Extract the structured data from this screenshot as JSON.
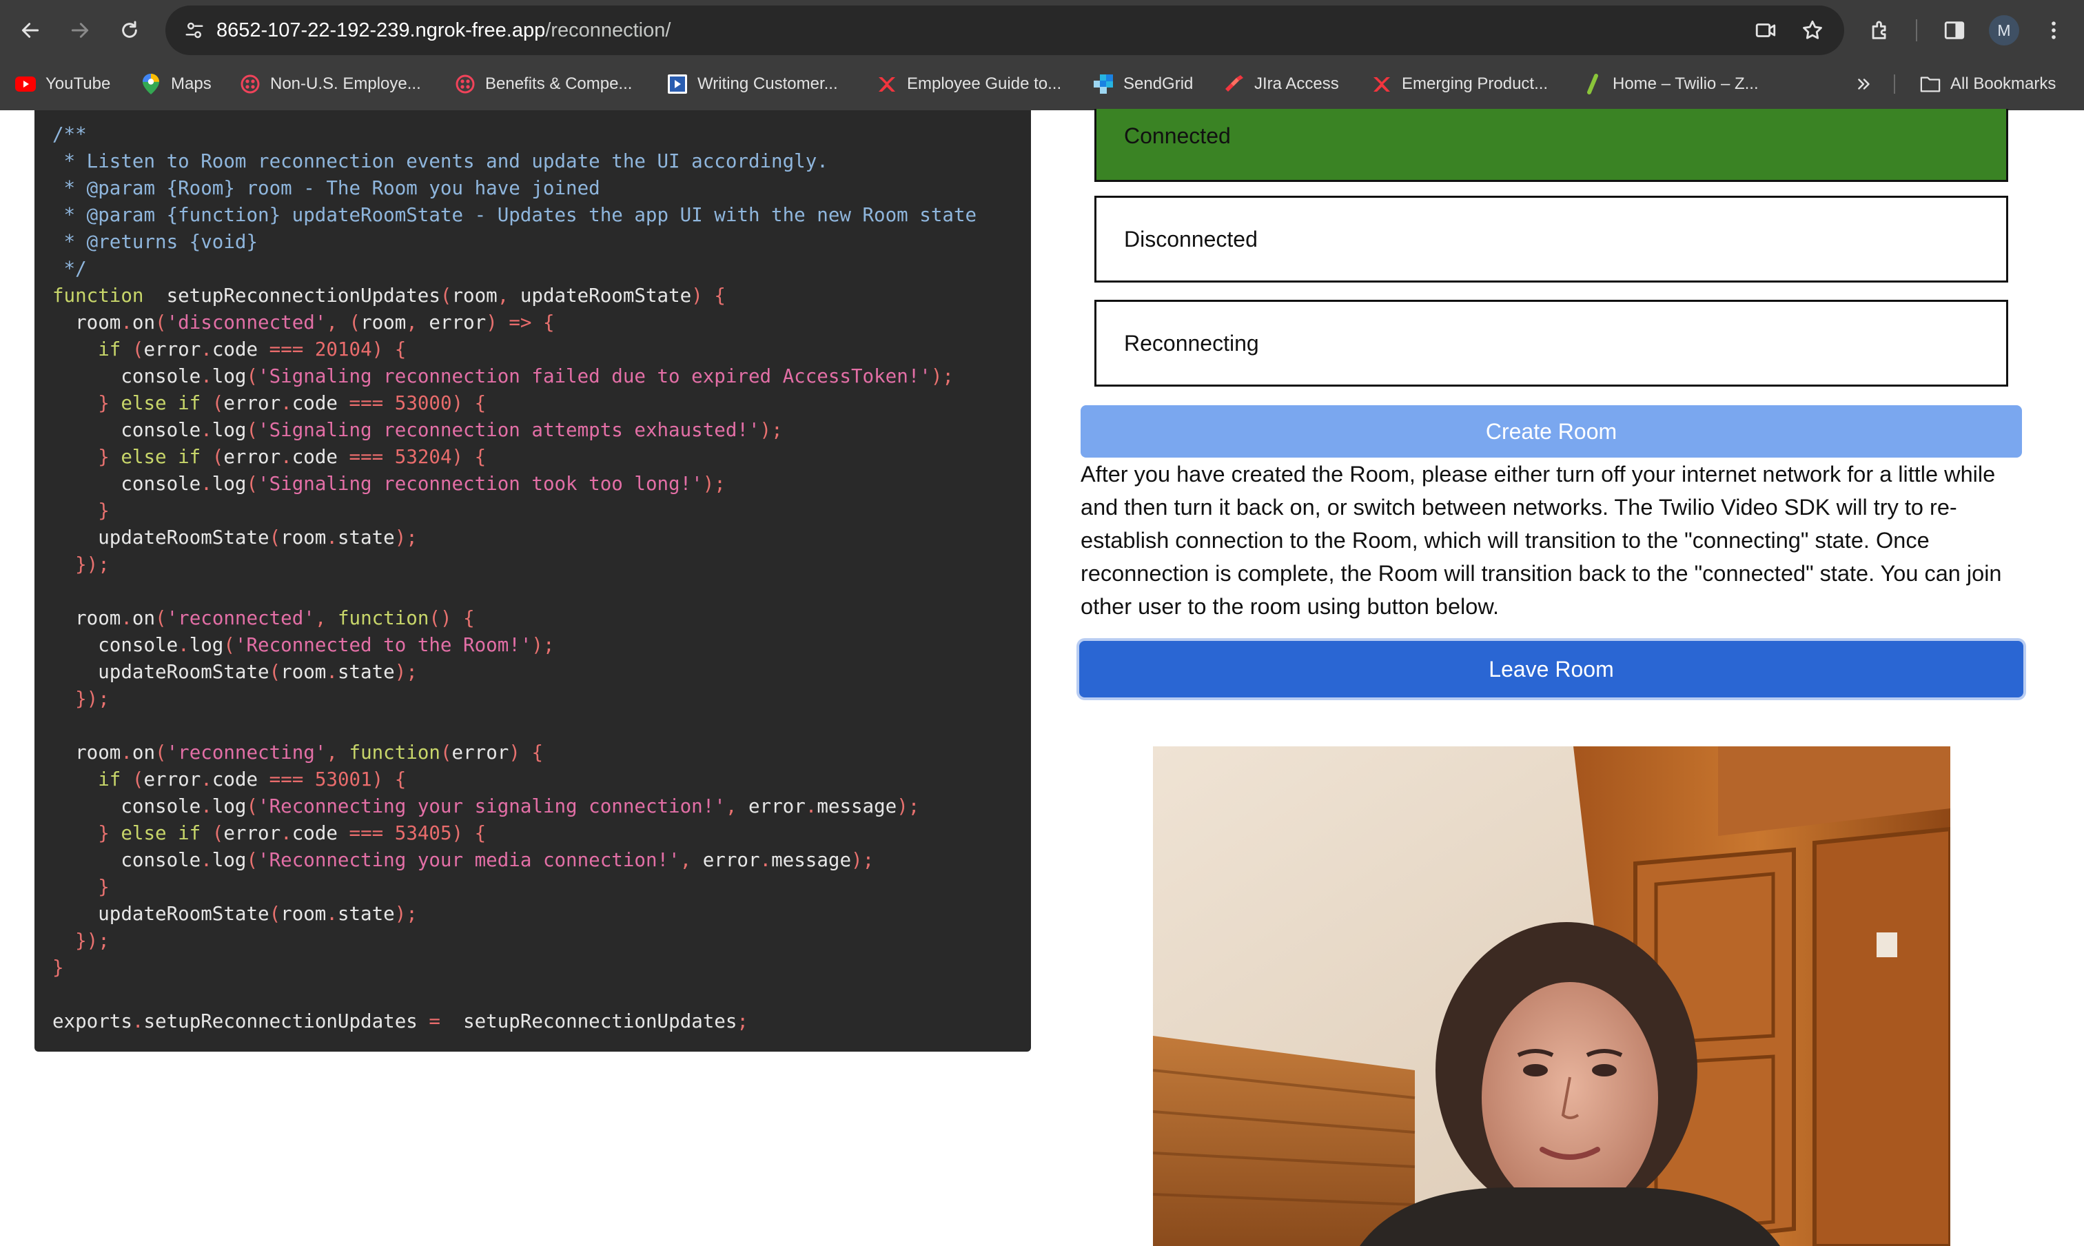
{
  "browser": {
    "url_host": "8652-107-22-192-239.ngrok-free.app",
    "url_path": "/reconnection/",
    "avatar_letter": "M",
    "bookmarks": [
      {
        "label": "YouTube",
        "icon": "youtube-icon"
      },
      {
        "label": "Maps",
        "icon": "maps-icon"
      },
      {
        "label": "Non-U.S. Employe...",
        "icon": "globe-icon"
      },
      {
        "label": "Benefits & Compe...",
        "icon": "globe-icon"
      },
      {
        "label": "Writing Customer...",
        "icon": "docs-icon"
      },
      {
        "label": "Employee Guide to...",
        "icon": "x-logo-icon"
      },
      {
        "label": "SendGrid",
        "icon": "sendgrid-icon"
      },
      {
        "label": "JIra Access",
        "icon": "jira-icon"
      },
      {
        "label": "Emerging Product...",
        "icon": "x-logo-icon"
      },
      {
        "label": "Home – Twilio – Z...",
        "icon": "leaf-icon"
      }
    ],
    "all_bookmarks_label": "All Bookmarks",
    "colors": {
      "chrome": "#3c3c3c",
      "omnibox": "#282828"
    }
  },
  "code": {
    "lines": [
      [
        [
          "c-com",
          "/**"
        ]
      ],
      [
        [
          "c-com",
          " * Listen to Room reconnection events and update the UI accordingly."
        ]
      ],
      [
        [
          "c-com",
          " * @param {Room} room - The Room you have joined"
        ]
      ],
      [
        [
          "c-com",
          " * @param {function} updateRoomState - Updates the app UI with the new Room state"
        ]
      ],
      [
        [
          "c-com",
          " * @returns {void}"
        ]
      ],
      [
        [
          "c-com",
          " */"
        ]
      ],
      [
        [
          "c-kw",
          "function"
        ],
        [
          "",
          "  setupReconnectionUpdates"
        ],
        [
          "c-p",
          "("
        ],
        [
          "",
          "room"
        ],
        [
          "c-p",
          ", "
        ],
        [
          "",
          "updateRoomState"
        ],
        [
          "c-p",
          ") {"
        ]
      ],
      [
        [
          "",
          "  room"
        ],
        [
          "c-p",
          "."
        ],
        [
          "",
          "on"
        ],
        [
          "c-p",
          "("
        ],
        [
          "c-str",
          "'disconnected'"
        ],
        [
          "c-p",
          ", ("
        ],
        [
          "",
          "room"
        ],
        [
          "c-p",
          ", "
        ],
        [
          "",
          "error"
        ],
        [
          "c-p",
          ") "
        ],
        [
          "c-op",
          "=>"
        ],
        [
          "c-p",
          " {"
        ]
      ],
      [
        [
          "",
          "    "
        ],
        [
          "c-kw",
          "if"
        ],
        [
          "c-p",
          " ("
        ],
        [
          "",
          "error"
        ],
        [
          "c-p",
          "."
        ],
        [
          "",
          "code "
        ],
        [
          "c-op",
          "==="
        ],
        [
          "c-num",
          " 20104"
        ],
        [
          "c-p",
          ") {"
        ]
      ],
      [
        [
          "",
          "      console"
        ],
        [
          "c-p",
          "."
        ],
        [
          "",
          "log"
        ],
        [
          "c-p",
          "("
        ],
        [
          "c-str",
          "'Signaling reconnection failed due to expired AccessToken!'"
        ],
        [
          "c-p",
          ");"
        ]
      ],
      [
        [
          "c-p",
          "    } "
        ],
        [
          "c-kw",
          "else if"
        ],
        [
          "c-p",
          " ("
        ],
        [
          "",
          "error"
        ],
        [
          "c-p",
          "."
        ],
        [
          "",
          "code "
        ],
        [
          "c-op",
          "==="
        ],
        [
          "c-num",
          " 53000"
        ],
        [
          "c-p",
          ") {"
        ]
      ],
      [
        [
          "",
          "      console"
        ],
        [
          "c-p",
          "."
        ],
        [
          "",
          "log"
        ],
        [
          "c-p",
          "("
        ],
        [
          "c-str",
          "'Signaling reconnection attempts exhausted!'"
        ],
        [
          "c-p",
          ");"
        ]
      ],
      [
        [
          "c-p",
          "    } "
        ],
        [
          "c-kw",
          "else if"
        ],
        [
          "c-p",
          " ("
        ],
        [
          "",
          "error"
        ],
        [
          "c-p",
          "."
        ],
        [
          "",
          "code "
        ],
        [
          "c-op",
          "==="
        ],
        [
          "c-num",
          " 53204"
        ],
        [
          "c-p",
          ") {"
        ]
      ],
      [
        [
          "",
          "      console"
        ],
        [
          "c-p",
          "."
        ],
        [
          "",
          "log"
        ],
        [
          "c-p",
          "("
        ],
        [
          "c-str",
          "'Signaling reconnection took too long!'"
        ],
        [
          "c-p",
          ");"
        ]
      ],
      [
        [
          "c-p",
          "    }"
        ]
      ],
      [
        [
          "",
          "    updateRoomState"
        ],
        [
          "c-p",
          "("
        ],
        [
          "",
          "room"
        ],
        [
          "c-p",
          "."
        ],
        [
          "",
          "state"
        ],
        [
          "c-p",
          ");"
        ]
      ],
      [
        [
          "c-p",
          "  });"
        ]
      ],
      [
        [
          "",
          ""
        ]
      ],
      [
        [
          "",
          "  room"
        ],
        [
          "c-p",
          "."
        ],
        [
          "",
          "on"
        ],
        [
          "c-p",
          "("
        ],
        [
          "c-str",
          "'reconnected'"
        ],
        [
          "c-p",
          ", "
        ],
        [
          "c-kw",
          "function"
        ],
        [
          "c-p",
          "() {"
        ]
      ],
      [
        [
          "",
          "    console"
        ],
        [
          "c-p",
          "."
        ],
        [
          "",
          "log"
        ],
        [
          "c-p",
          "("
        ],
        [
          "c-str",
          "'Reconnected to the Room!'"
        ],
        [
          "c-p",
          ");"
        ]
      ],
      [
        [
          "",
          "    updateRoomState"
        ],
        [
          "c-p",
          "("
        ],
        [
          "",
          "room"
        ],
        [
          "c-p",
          "."
        ],
        [
          "",
          "state"
        ],
        [
          "c-p",
          ");"
        ]
      ],
      [
        [
          "c-p",
          "  });"
        ]
      ],
      [
        [
          "",
          ""
        ]
      ],
      [
        [
          "",
          "  room"
        ],
        [
          "c-p",
          "."
        ],
        [
          "",
          "on"
        ],
        [
          "c-p",
          "("
        ],
        [
          "c-str",
          "'reconnecting'"
        ],
        [
          "c-p",
          ", "
        ],
        [
          "c-kw",
          "function"
        ],
        [
          "c-p",
          "("
        ],
        [
          "",
          "error"
        ],
        [
          "c-p",
          ") {"
        ]
      ],
      [
        [
          "",
          "    "
        ],
        [
          "c-kw",
          "if"
        ],
        [
          "c-p",
          " ("
        ],
        [
          "",
          "error"
        ],
        [
          "c-p",
          "."
        ],
        [
          "",
          "code "
        ],
        [
          "c-op",
          "==="
        ],
        [
          "c-num",
          " 53001"
        ],
        [
          "c-p",
          ") {"
        ]
      ],
      [
        [
          "",
          "      console"
        ],
        [
          "c-p",
          "."
        ],
        [
          "",
          "log"
        ],
        [
          "c-p",
          "("
        ],
        [
          "c-str",
          "'Reconnecting your signaling connection!'"
        ],
        [
          "c-p",
          ", "
        ],
        [
          "",
          "error"
        ],
        [
          "c-p",
          "."
        ],
        [
          "",
          "message"
        ],
        [
          "c-p",
          ");"
        ]
      ],
      [
        [
          "c-p",
          "    } "
        ],
        [
          "c-kw",
          "else if"
        ],
        [
          "c-p",
          " ("
        ],
        [
          "",
          "error"
        ],
        [
          "c-p",
          "."
        ],
        [
          "",
          "code "
        ],
        [
          "c-op",
          "==="
        ],
        [
          "c-num",
          " 53405"
        ],
        [
          "c-p",
          ") {"
        ]
      ],
      [
        [
          "",
          "      console"
        ],
        [
          "c-p",
          "."
        ],
        [
          "",
          "log"
        ],
        [
          "c-p",
          "("
        ],
        [
          "c-str",
          "'Reconnecting your media connection!'"
        ],
        [
          "c-p",
          ", "
        ],
        [
          "",
          "error"
        ],
        [
          "c-p",
          "."
        ],
        [
          "",
          "message"
        ],
        [
          "c-p",
          ");"
        ]
      ],
      [
        [
          "c-p",
          "    }"
        ]
      ],
      [
        [
          "",
          "    updateRoomState"
        ],
        [
          "c-p",
          "("
        ],
        [
          "",
          "room"
        ],
        [
          "c-p",
          "."
        ],
        [
          "",
          "state"
        ],
        [
          "c-p",
          ");"
        ]
      ],
      [
        [
          "c-p",
          "  });"
        ]
      ],
      [
        [
          "c-p",
          "}"
        ]
      ],
      [
        [
          "",
          ""
        ]
      ],
      [
        [
          "",
          "exports"
        ],
        [
          "c-p",
          "."
        ],
        [
          "",
          "setupReconnectionUpdates "
        ],
        [
          "c-op",
          "="
        ],
        [
          "",
          ""
        ],
        [
          "",
          "  setupReconnectionUpdates"
        ],
        [
          "c-p",
          ";"
        ]
      ]
    ]
  },
  "room_states": {
    "connected": "Connected",
    "disconnected": "Disconnected",
    "reconnecting": "Reconnecting",
    "active_color": "#3a8324"
  },
  "buttons": {
    "create_room": "Create Room",
    "leave_room": "Leave Room"
  },
  "instructions": "After you have created the Room, please either turn off your internet network for a little while and then turn it back on, or switch between networks. The Twilio Video SDK will try to re-establish connection to the Room, which will transition to the \"connecting\" state. Once reconnection is complete, the Room will transition back to the \"connected\" state. You can join other user to the room using button below."
}
